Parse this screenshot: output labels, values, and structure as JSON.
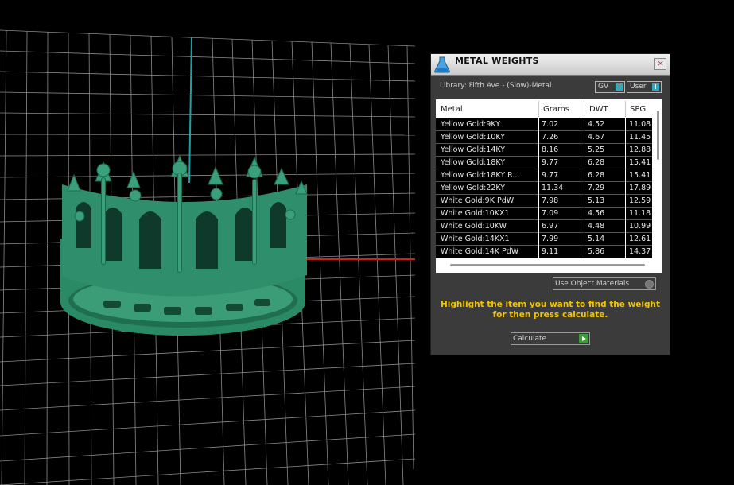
{
  "panel": {
    "title": "METAL WEIGHTS",
    "close_label": "×",
    "library_label": "Library: Fifth Ave - (Slow)-Metal",
    "gv_toggle": {
      "label": "GV",
      "state": "I"
    },
    "user_toggle": {
      "label": "User",
      "state": "I"
    },
    "table": {
      "columns": [
        "Metal",
        "Grams",
        "DWT",
        "SPG"
      ],
      "rows": [
        [
          "Yellow Gold:9KY",
          "7.02",
          "4.52",
          "11.08"
        ],
        [
          "Yellow Gold:10KY",
          "7.26",
          "4.67",
          "11.45"
        ],
        [
          "Yellow Gold:14KY",
          "8.16",
          "5.25",
          "12.88"
        ],
        [
          "Yellow Gold:18KY",
          "9.77",
          "6.28",
          "15.41"
        ],
        [
          "Yellow Gold:18KY R...",
          "9.77",
          "6.28",
          "15.41"
        ],
        [
          "Yellow Gold:22KY",
          "11.34",
          "7.29",
          "17.89"
        ],
        [
          "White Gold:9K PdW",
          "7.98",
          "5.13",
          "12.59"
        ],
        [
          "White Gold:10KX1",
          "7.09",
          "4.56",
          "11.18"
        ],
        [
          "White Gold:10KW",
          "6.97",
          "4.48",
          "10.99"
        ],
        [
          "White Gold:14KX1",
          "7.99",
          "5.14",
          "12.61"
        ],
        [
          "White Gold:14K PdW",
          "9.11",
          "5.86",
          "14.37"
        ]
      ]
    },
    "use_object_materials_label": "Use Object Materials",
    "hint_line1": "Highlight the item you want to find the weight",
    "hint_line2": "for then press calculate.",
    "calculate_label": "Calculate"
  },
  "colors": {
    "viewport_bg": "#000000",
    "grid": "#8a8a8a",
    "axis_y": "#1aa3a6",
    "axis_x": "#d11f1f",
    "model": "#2f8f6c",
    "hint": "#f2c400"
  },
  "icons": {
    "title_icon": "flask-icon",
    "close": "close-icon",
    "calculate": "play-icon"
  }
}
